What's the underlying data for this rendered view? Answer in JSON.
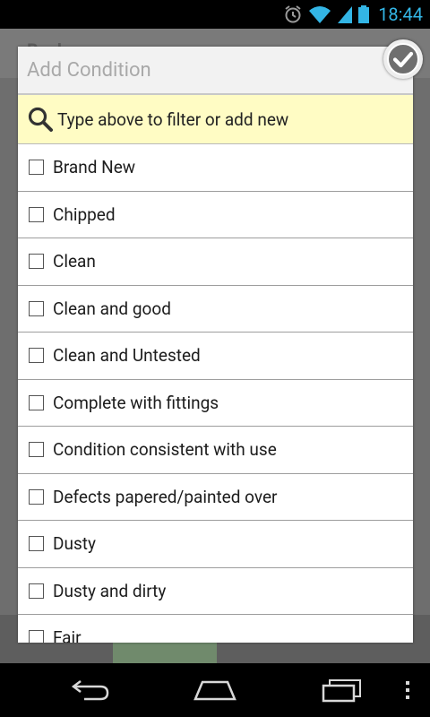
{
  "status_bar": {
    "time": "18:44"
  },
  "background": {
    "back_label": "Back"
  },
  "dialog": {
    "title": "Add Condition",
    "search_placeholder": "Type above to filter or add new",
    "items": [
      {
        "label": "Brand New",
        "checked": false
      },
      {
        "label": "Chipped",
        "checked": false
      },
      {
        "label": "Clean",
        "checked": false
      },
      {
        "label": "Clean and good",
        "checked": false
      },
      {
        "label": "Clean and Untested",
        "checked": false
      },
      {
        "label": "Complete with fittings",
        "checked": false
      },
      {
        "label": "Condition consistent with use",
        "checked": false
      },
      {
        "label": "Defects papered/painted over",
        "checked": false
      },
      {
        "label": "Dusty",
        "checked": false
      },
      {
        "label": "Dusty and dirty",
        "checked": false
      },
      {
        "label": "Fair",
        "checked": false
      }
    ]
  },
  "icons": {
    "confirm": "check-circle-icon",
    "search": "magnifier-icon",
    "nav_back": "back-icon",
    "nav_home": "home-icon",
    "nav_recents": "recents-icon",
    "nav_menu": "overflow-menu-icon"
  },
  "colors": {
    "status_time": "#33b5e5",
    "search_bg": "#fffcc4",
    "header_bg": "#f2f2f2"
  }
}
